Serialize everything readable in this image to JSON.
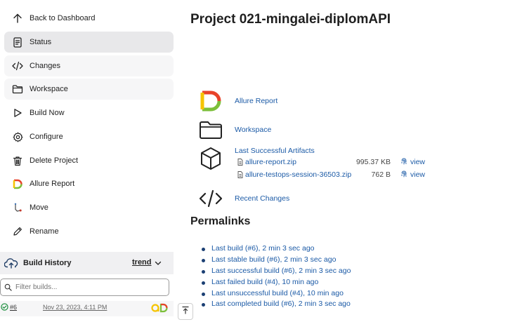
{
  "sidebar": {
    "items": [
      {
        "label": "Back to Dashboard",
        "icon": "arrow-up-icon"
      },
      {
        "label": "Status",
        "icon": "document-icon"
      },
      {
        "label": "Changes",
        "icon": "code-icon"
      },
      {
        "label": "Workspace",
        "icon": "folder-icon"
      },
      {
        "label": "Build Now",
        "icon": "play-icon"
      },
      {
        "label": "Configure",
        "icon": "gear-icon"
      },
      {
        "label": "Delete Project",
        "icon": "trash-icon"
      },
      {
        "label": "Allure Report",
        "icon": "allure-icon"
      },
      {
        "label": "Move",
        "icon": "move-icon"
      },
      {
        "label": "Rename",
        "icon": "pencil-icon"
      }
    ],
    "active_item": "Status"
  },
  "build_history": {
    "title": "Build History",
    "trend_label": "trend",
    "filter_placeholder": "Filter builds...",
    "builds": [
      {
        "number": "#6",
        "date": "Nov 23, 2023, 4:11 PM",
        "status": "success"
      }
    ]
  },
  "main": {
    "title": "Project 021-mingalei-diplomAPI",
    "tasks": {
      "allure": "Allure Report",
      "workspace": "Workspace",
      "recent_changes": "Recent Changes"
    },
    "artifacts": {
      "title": "Last Successful Artifacts",
      "files": [
        {
          "name": "allure-report.zip",
          "size": "995.37 KB",
          "view": "view"
        },
        {
          "name": "allure-testops-session-36503.zip",
          "size": "762 B",
          "view": "view"
        }
      ]
    },
    "permalinks": {
      "title": "Permalinks",
      "links": [
        "Last build (#6), 2 min 3 sec ago",
        "Last stable build (#6), 2 min 3 sec ago",
        "Last successful build (#6), 2 min 3 sec ago",
        "Last failed build (#4), 10 min ago",
        "Last unsuccessful build (#4), 10 min ago",
        "Last completed build (#6), 2 min 3 sec ago"
      ]
    }
  },
  "colors": {
    "link": "#1b5aa6",
    "active_bg": "#e8e8ea",
    "success": "#138a36",
    "allure_yellow": "#f5c400",
    "allure_red": "#e8432a",
    "allure_green": "#7cbf3a"
  }
}
